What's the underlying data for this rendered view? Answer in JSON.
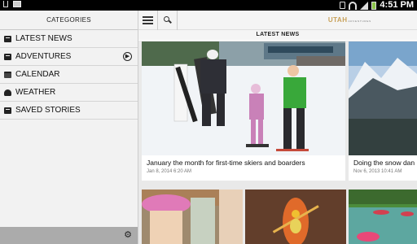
{
  "status_bar": {
    "time": "4:51 PM",
    "icons": [
      "usb-icon",
      "image-icon",
      "vibrate-icon",
      "wifi-icon",
      "signal-icon",
      "battery-icon"
    ]
  },
  "sidebar": {
    "header": "CATEGORIES",
    "items": [
      {
        "label": "LATEST NEWS",
        "icon": "newspaper-icon"
      },
      {
        "label": "ADVENTURES",
        "icon": "newspaper-icon",
        "has_arrow": true
      },
      {
        "label": "CALENDAR",
        "icon": "calendar-icon"
      },
      {
        "label": "WEATHER",
        "icon": "weather-icon"
      },
      {
        "label": "SAVED STORIES",
        "icon": "newspaper-icon"
      }
    ],
    "footer_icon": "settings-icon"
  },
  "toolbar": {
    "menu_icon": "hamburger-menu-icon",
    "search_icon": "search-icon",
    "logo_text": "UTAH",
    "logo_sub": "ADVENTURES"
  },
  "main": {
    "section_title": "LATEST NEWS",
    "cards": [
      {
        "caption": "January the month for first-time skiers and boarders",
        "date": "Jan 8, 2014 6:20 AM"
      },
      {
        "caption": "Doing the snow dan",
        "date": "Nov 6, 2013 10:41 AM"
      }
    ]
  },
  "colors": {
    "accent_logo": "#c8a058",
    "sidebar_bg": "#f2f2f2",
    "sidebar_footer": "#ababab",
    "feed_bg": "#e9e9e9"
  }
}
